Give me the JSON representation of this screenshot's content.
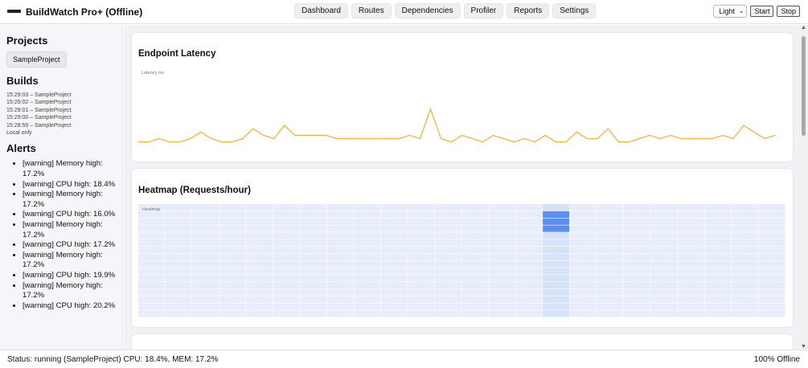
{
  "app": {
    "title": "BuildWatch Pro+ (Offline)"
  },
  "nav": {
    "items": [
      "Dashboard",
      "Routes",
      "Dependencies",
      "Profiler",
      "Reports",
      "Settings"
    ]
  },
  "controls": {
    "theme_value": "Light",
    "start_label": "Start",
    "stop_label": "Stop"
  },
  "sidebar": {
    "projects_heading": "Projects",
    "project_button": "SampleProject",
    "builds_heading": "Builds",
    "builds": [
      "15:29:03 – SampleProject",
      "15:29:02 – SampleProject",
      "15:29:01 – SampleProject",
      "15:29:00 – SampleProject",
      "15:28:59 – SampleProject"
    ],
    "builds_note": "Local only",
    "alerts_heading": "Alerts",
    "alerts": [
      "[warning] Memory high: 17.2%",
      "[warning] CPU high: 18.4%",
      "[warning] Memory high: 17.2%",
      "[warning] CPU high: 16.0%",
      "[warning] Memory high: 17.2%",
      "[warning] CPU high: 17.2%",
      "[warning] Memory high: 17.2%",
      "[warning] CPU high: 19.9%",
      "[warning] Memory high: 17.2%",
      "[warning] CPU high: 20.2%"
    ]
  },
  "cards": {
    "latency_title": "Endpoint Latency",
    "heatmap_title": "Heatmap (Requests/hour)"
  },
  "status": {
    "left": "Status: running (SampleProject)   CPU: 18.4%, MEM: 17.2%",
    "right": "100% Offline"
  },
  "colors": {
    "line": "#f6b23c",
    "heat_base": "#e7edfb",
    "heat_mid": "#d6e1fa",
    "heat_high": "#5a8ef2"
  },
  "chart_data": [
    {
      "type": "line",
      "title": "",
      "ylabel": "Latency ms",
      "grid": false,
      "values": [
        54,
        54,
        55,
        54,
        54,
        55,
        57,
        55,
        54,
        54,
        55,
        58,
        56,
        55,
        59,
        56,
        56,
        56,
        56,
        55,
        55,
        55,
        55,
        55,
        55,
        55,
        56,
        55,
        64,
        55,
        54,
        56,
        55,
        54,
        56,
        55,
        54,
        55,
        54,
        56,
        54,
        54,
        57,
        55,
        55,
        58,
        54,
        54,
        55,
        56,
        55,
        56,
        55,
        55,
        55,
        55,
        56,
        55,
        59,
        57,
        55,
        56
      ]
    },
    {
      "type": "heatmap",
      "title": "Heatmap",
      "rows": 16,
      "cols": 24,
      "values": [
        [
          0,
          0,
          0,
          0,
          0,
          0,
          0,
          0,
          0,
          0,
          0,
          0,
          0,
          0,
          0,
          1,
          0,
          0,
          0,
          0,
          0,
          0,
          0,
          0
        ],
        [
          0,
          0,
          0,
          0,
          0,
          0,
          0,
          0,
          0,
          0,
          0,
          0,
          0,
          0,
          0,
          5,
          0,
          0,
          0,
          0,
          0,
          0,
          0,
          0
        ],
        [
          0,
          0,
          0,
          0,
          0,
          0,
          0,
          0,
          0,
          0,
          0,
          0,
          0,
          0,
          0,
          5,
          0,
          0,
          0,
          0,
          0,
          0,
          0,
          0
        ],
        [
          0,
          0,
          0,
          0,
          0,
          0,
          0,
          0,
          0,
          0,
          0,
          0,
          0,
          0,
          0,
          5,
          0,
          0,
          0,
          0,
          0,
          0,
          0,
          0
        ],
        [
          0,
          0,
          0,
          0,
          0,
          0,
          0,
          0,
          0,
          0,
          0,
          0,
          0,
          0,
          0,
          1,
          0,
          0,
          0,
          0,
          0,
          0,
          0,
          0
        ],
        [
          0,
          0,
          0,
          0,
          0,
          0,
          0,
          0,
          0,
          0,
          0,
          0,
          0,
          0,
          0,
          1,
          0,
          0,
          0,
          0,
          0,
          0,
          0,
          0
        ],
        [
          0,
          0,
          0,
          0,
          0,
          0,
          0,
          0,
          0,
          0,
          0,
          0,
          0,
          0,
          0,
          1,
          0,
          0,
          0,
          0,
          0,
          0,
          0,
          0
        ],
        [
          0,
          0,
          0,
          0,
          0,
          0,
          0,
          0,
          0,
          0,
          0,
          0,
          0,
          0,
          0,
          1,
          0,
          0,
          0,
          0,
          0,
          0,
          0,
          0
        ],
        [
          0,
          0,
          0,
          0,
          0,
          0,
          0,
          0,
          0,
          0,
          0,
          0,
          0,
          0,
          0,
          1,
          0,
          0,
          0,
          0,
          0,
          0,
          0,
          0
        ],
        [
          0,
          0,
          0,
          0,
          0,
          0,
          0,
          0,
          0,
          0,
          0,
          0,
          0,
          0,
          0,
          1,
          0,
          0,
          0,
          0,
          0,
          0,
          0,
          0
        ],
        [
          0,
          0,
          0,
          0,
          0,
          0,
          0,
          0,
          0,
          0,
          0,
          0,
          0,
          0,
          0,
          1,
          0,
          0,
          0,
          0,
          0,
          0,
          0,
          0
        ],
        [
          0,
          0,
          0,
          0,
          0,
          0,
          0,
          0,
          0,
          0,
          0,
          0,
          0,
          0,
          0,
          1,
          0,
          0,
          0,
          0,
          0,
          0,
          0,
          0
        ],
        [
          0,
          0,
          0,
          0,
          0,
          0,
          0,
          0,
          0,
          0,
          0,
          0,
          0,
          0,
          0,
          1,
          0,
          0,
          0,
          0,
          0,
          0,
          0,
          0
        ],
        [
          0,
          0,
          0,
          0,
          0,
          0,
          0,
          0,
          0,
          0,
          0,
          0,
          0,
          0,
          0,
          1,
          0,
          0,
          0,
          0,
          0,
          0,
          0,
          0
        ],
        [
          0,
          0,
          0,
          0,
          0,
          0,
          0,
          0,
          0,
          0,
          0,
          0,
          0,
          0,
          0,
          1,
          0,
          0,
          0,
          0,
          0,
          0,
          0,
          0
        ],
        [
          0,
          0,
          0,
          0,
          0,
          0,
          0,
          0,
          0,
          0,
          0,
          0,
          0,
          0,
          0,
          1,
          0,
          0,
          0,
          0,
          0,
          0,
          0,
          0
        ]
      ]
    }
  ]
}
